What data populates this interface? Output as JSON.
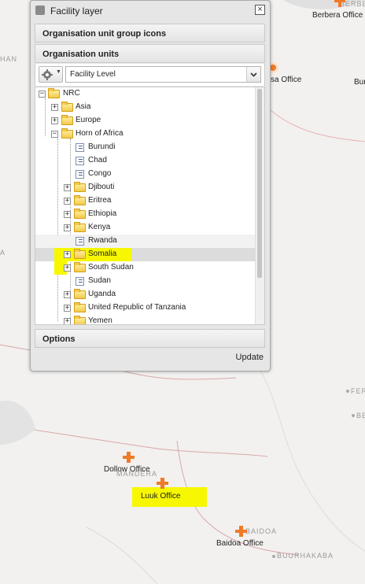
{
  "window": {
    "title": "Facility layer",
    "close_glyph": "×",
    "sections": {
      "group_icons": "Organisation unit group icons",
      "org_units": "Organisation units",
      "options": "Options"
    },
    "level_select": {
      "value": "Facility Level"
    },
    "tree": {
      "root": "NRC",
      "continents": [
        "Asia",
        "Europe",
        "Horn of Africa"
      ],
      "countries": [
        "Burundi",
        "Chad",
        "Congo",
        "Djibouti",
        "Eritrea",
        "Ethiopia",
        "Kenya",
        "Rwanda",
        "Somalia",
        "South Sudan",
        "Sudan",
        "Uganda",
        "United Republic of Tanzania",
        "Yemen"
      ],
      "selected": "Somalia"
    },
    "update_label": "Update"
  },
  "map": {
    "offices": [
      "Berbera Office",
      "Dollow Office",
      "Luuk Office",
      "Baidoa Office"
    ],
    "partial_office": "sa Office",
    "cut_label": "Bur",
    "places": [
      "BERBE",
      "HAN",
      "A",
      "FER",
      "BE",
      "MANDERA",
      "BAIDOA",
      "BUURHAKABA"
    ],
    "highlight_color": "#f6f700",
    "marker_color": "#f07a28"
  }
}
